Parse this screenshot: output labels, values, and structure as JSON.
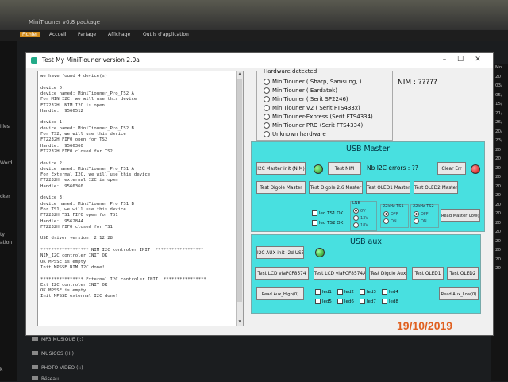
{
  "explorer": {
    "title": "MiniTiouner v0.8 package",
    "tabs": [
      "Fichier",
      "Accueil",
      "Partage",
      "Affichage",
      "Outils d'application"
    ],
    "left_labels": [
      "illes",
      "Word",
      "cker",
      "ty",
      "ation",
      "k"
    ],
    "right_labels": [
      "Mo",
      "20",
      "03/",
      "05/",
      "15/",
      "21/",
      "26/",
      "20/",
      "23/",
      "20",
      "20",
      "20",
      "20",
      "20",
      "20",
      "20",
      "20",
      "20",
      "20",
      "20",
      "20",
      "20",
      "20"
    ],
    "bottom_items": [
      "MP3 MUSIQUE (J:)",
      "MUSICOS (H:)",
      "PHOTO VIDEO (I:)",
      "Réseau"
    ]
  },
  "window": {
    "title": "Test My MiniTiouner version 2.0a",
    "controls": [
      "–",
      "☐",
      "✕"
    ]
  },
  "log_lines": [
    "we have found 4 device(s)",
    "",
    "device 0:",
    "device named: MiniTiouner_Pro_TS2 A",
    "For MIN I2C, we will use this device",
    "FT2232H  NIM I2C is open",
    "Handle:  9566512",
    "",
    "device 1:",
    "device named: MiniTiouner_Pro_TS2 B",
    "For TS2, we will use this device",
    "FT2232H FIFO open for TS2",
    "Handle:  9566360",
    "FT2232H FIFO closed for TS2",
    "",
    "device 2:",
    "device named: MiniTiouner_Pro_TS1 A",
    "For External I2C, we will use this device",
    "FT2232H  external I2C is open",
    "Handle:  9566360",
    "",
    "device 3:",
    "device named: MiniTiouner_Pro_TS1 B",
    "For TS1, we will use this device",
    "FT2232H TS1 FIFO open for TS1",
    "Handle:  9562844",
    "FT2232H FIFO closed for TS1",
    "",
    "USB driver version: 2.12.28",
    "",
    "****************** NIM I2C controler INIT  ******************",
    "NIM_I2C controler INIT OK",
    "OK MPSSE is empty",
    "Init MPSSE NIM I2C done!",
    "",
    "**************** External I2C controler INIT  ****************",
    "Ext_I2C controler INIT OK",
    "OK MPSSE is empty",
    "Init MPSSE external I2C done!"
  ],
  "hardware": {
    "legend": "Hardware detected",
    "options": [
      "MiniTiouner ( Sharp, Samsung, )",
      "MiniTiouner ( Eardatek)",
      "MiniTiouner ( Serit SP2246)",
      "MiniTiouner V2 ( Serit FTS433x)",
      "MiniTiouner-Express (Serit FTS4334)",
      "MiniTiouner PRO  (Serit FTS4334)",
      "Unknown hardware"
    ]
  },
  "nim_label": "NIM : ?????",
  "usb_master": {
    "title": "USB Master",
    "i2c_master_init": "I2C Master init (NIM)",
    "test_nim": "Test NIM",
    "errors_label": "Nb I2C errors : ??",
    "clear_err": "Clear Err",
    "buttons_row2": [
      "Test Digole Master",
      "Test Digole 2.6 Master",
      "Test OLED1 Master",
      "Test OLED2 Master"
    ],
    "led_ts1": "led TS1 OK",
    "led_ts2": "led TS2 OK",
    "lnb_title": "LNB",
    "lnb_options": [
      "0V",
      "13V",
      "18V"
    ],
    "khz_ts1_title": "22kHz TS1",
    "khz_ts2_title": "22kHz TS2",
    "onoff": [
      "OFF",
      "ON"
    ],
    "read_master_low": "Read Master_Low(0)"
  },
  "usb_aux": {
    "title": "USB aux",
    "i2c_aux_init": "I2C AUX init (2d USB)",
    "buttons_row2": [
      "Test LCD viaPCF8574",
      "Test LCD viaPCF8574A",
      "Test Digole Aux",
      "Test OLED1",
      "Test OLED2"
    ],
    "read_aux_high": "Read Aux_High(0)",
    "leds_row1": [
      "led1",
      "led2",
      "led3",
      "led4"
    ],
    "leds_row2": [
      "led5",
      "led6",
      "led7",
      "led8"
    ],
    "read_aux_low": "Read Aux_Low(0)"
  },
  "overlay_date": "19/10/2019",
  "colors": {
    "panel": "#48e0e0",
    "date": "#e06020",
    "led_on": "#1a8a1a",
    "led_err": "#c00000"
  }
}
